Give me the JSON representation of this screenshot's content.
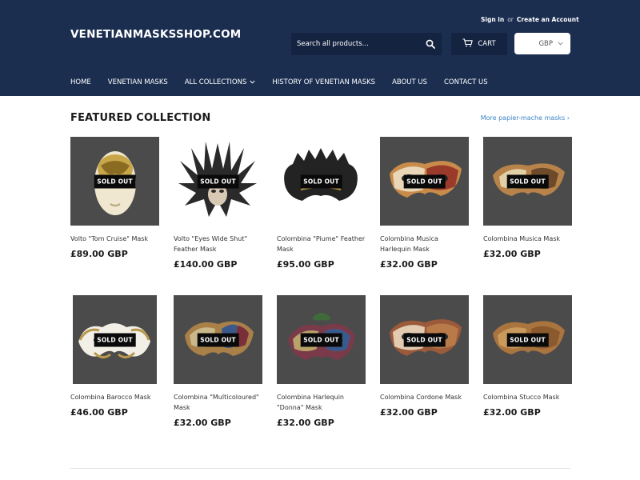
{
  "header": {
    "logo": "VENETIANMASKSSHOP.COM",
    "sign_in": "Sign in",
    "or": "or",
    "create_account": "Create an Account",
    "search_placeholder": "Search all products...",
    "cart_label": "CART",
    "currency": "GBP"
  },
  "nav": {
    "items": [
      {
        "label": "HOME"
      },
      {
        "label": "VENETIAN MASKS"
      },
      {
        "label": "ALL COLLECTIONS"
      },
      {
        "label": "HISTORY OF VENETIAN MASKS"
      },
      {
        "label": "ABOUT US"
      },
      {
        "label": "CONTACT US"
      }
    ]
  },
  "featured": {
    "title": "FEATURED COLLECTION",
    "more_link": "More papier-mache masks ›",
    "badge": "SOLD OUT",
    "products": [
      {
        "title": "Volto \"Tom Cruise\" Mask",
        "price": "£89.00 GBP"
      },
      {
        "title": "Volto \"Eyes Wide Shut\" Feather Mask",
        "price": "£140.00 GBP"
      },
      {
        "title": "Colombina \"Piume\" Feather Mask",
        "price": "£95.00 GBP"
      },
      {
        "title": "Colombina Musica Harlequin Mask",
        "price": "£32.00 GBP"
      },
      {
        "title": "Colombina Musica Mask",
        "price": "£32.00 GBP"
      },
      {
        "title": "Colombina Barocco Mask",
        "price": "£46.00 GBP"
      },
      {
        "title": "Colombina \"Multicoloured\" Mask",
        "price": "£32.00 GBP"
      },
      {
        "title": "Colombina Harlequin \"Donna\" Mask",
        "price": "£32.00 GBP"
      },
      {
        "title": "Colombina Cordone Mask",
        "price": "£32.00 GBP"
      },
      {
        "title": "Colombina Stucco Mask",
        "price": "£32.00 GBP"
      }
    ]
  },
  "colors": {
    "header_bg": "#1b2e50",
    "search_bg": "#142340",
    "thumb_bg": "#4b4b4b",
    "link": "#3d84c4"
  }
}
